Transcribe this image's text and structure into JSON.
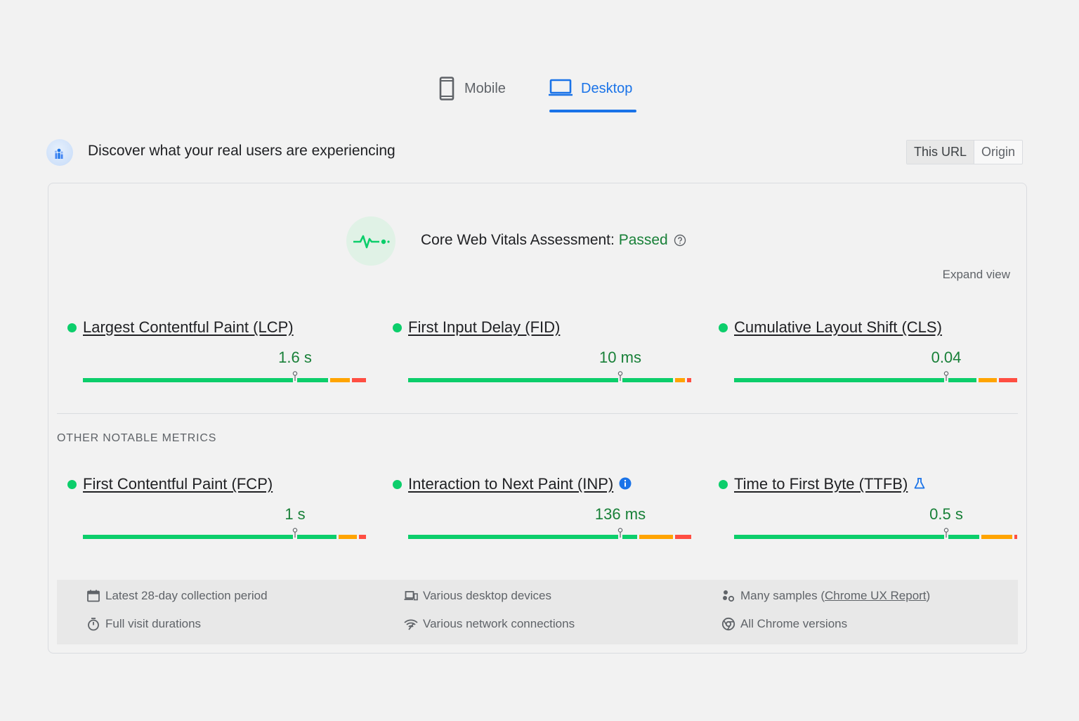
{
  "tabs": [
    {
      "label": "Mobile",
      "icon": "phone-icon",
      "active": false
    },
    {
      "label": "Desktop",
      "icon": "laptop-icon",
      "active": true
    }
  ],
  "header": {
    "title": "Discover what your real users are experiencing",
    "icon": "crux-users-icon",
    "toggle": [
      "This URL",
      "Origin"
    ],
    "toggle_active": "This URL"
  },
  "assessment": {
    "label": "Core Web Vitals Assessment: ",
    "status": "Passed",
    "status_color": "#188038",
    "icon": "pulse-icon",
    "help_icon": "help-circle-icon"
  },
  "expand_view": "Expand view",
  "core_metrics": [
    {
      "name": "Largest Contentful Paint (LCP)",
      "value": "1.6 s",
      "status_color": "#0cce6b",
      "marker": 0.75,
      "good": 0.865,
      "needs_improvement": 0.07
    },
    {
      "name": "First Input Delay (FID)",
      "value": "10 ms",
      "status_color": "#0cce6b",
      "marker": 0.75,
      "good": 0.935,
      "needs_improvement": 0.035
    },
    {
      "name": "Cumulative Layout Shift (CLS)",
      "value": "0.04",
      "status_color": "#0cce6b",
      "marker": 0.75,
      "good": 0.855,
      "needs_improvement": 0.065
    }
  ],
  "other_label": "OTHER NOTABLE METRICS",
  "other_metrics": [
    {
      "name": "First Contentful Paint (FCP)",
      "value": "1 s",
      "status_color": "#0cce6b",
      "marker": 0.75,
      "good": 0.895,
      "needs_improvement": 0.065
    },
    {
      "name": "Interaction to Next Paint (INP)",
      "value": "136 ms",
      "status_color": "#0cce6b",
      "marker": 0.75,
      "good": 0.81,
      "needs_improvement": 0.12,
      "extra_icon": "info-icon"
    },
    {
      "name": "Time to First Byte (TTFB)",
      "value": "0.5 s",
      "status_color": "#0cce6b",
      "marker": 0.75,
      "good": 0.865,
      "needs_improvement": 0.11,
      "extra_icon": "flask-icon"
    }
  ],
  "footer": {
    "col1": [
      {
        "icon": "calendar-icon",
        "text": "Latest 28-day collection period"
      },
      {
        "icon": "stopwatch-icon",
        "text": "Full visit durations"
      }
    ],
    "col2": [
      {
        "icon": "devices-icon",
        "text": "Various desktop devices"
      },
      {
        "icon": "network-icon",
        "text": "Various network connections"
      }
    ],
    "col3": [
      {
        "icon": "samples-icon",
        "text": "Many samples (",
        "link": "Chrome UX Report",
        "suffix": ")"
      },
      {
        "icon": "chrome-icon",
        "text": "All Chrome versions"
      }
    ]
  },
  "colors": {
    "good": "#0cce6b",
    "needs_improvement": "#ffa400",
    "poor": "#ff4e42",
    "accent": "#1a73e8"
  }
}
